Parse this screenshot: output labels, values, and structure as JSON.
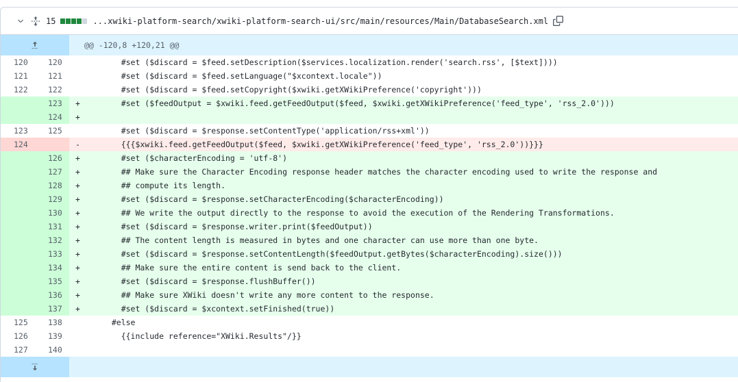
{
  "file": {
    "changes_count": "15",
    "diffstat": [
      "add",
      "add",
      "add",
      "add",
      "neutral"
    ],
    "path": "...xwiki-platform-search/xwiki-platform-search-ui/src/main/resources/Main/DatabaseSearch.xml"
  },
  "hunk_header": "@@ -120,8 +120,21 @@",
  "lines": [
    {
      "type": "ctx",
      "old": "120",
      "new": "120",
      "mark": "",
      "code": "    #set ($discard = $feed.setDescription($services.localization.render('search.rss', [$text])))"
    },
    {
      "type": "ctx",
      "old": "121",
      "new": "121",
      "mark": "",
      "code": "    #set ($discard = $feed.setLanguage(\"$xcontext.locale\"))"
    },
    {
      "type": "ctx",
      "old": "122",
      "new": "122",
      "mark": "",
      "code": "    #set ($discard = $feed.setCopyright($xwiki.getXWikiPreference('copyright')))"
    },
    {
      "type": "add",
      "old": "",
      "new": "123",
      "mark": "+",
      "code": "    #set ($feedOutput = $xwiki.feed.getFeedOutput($feed, $xwiki.getXWikiPreference('feed_type', 'rss_2.0')))"
    },
    {
      "type": "add",
      "old": "",
      "new": "124",
      "mark": "+",
      "code": ""
    },
    {
      "type": "ctx",
      "old": "123",
      "new": "125",
      "mark": "",
      "code": "    #set ($discard = $response.setContentType('application/rss+xml'))"
    },
    {
      "type": "del",
      "old": "124",
      "new": "",
      "mark": "-",
      "code": "    {{{$xwiki.feed.getFeedOutput($feed, $xwiki.getXWikiPreference('feed_type', 'rss_2.0'))}}}"
    },
    {
      "type": "add",
      "old": "",
      "new": "126",
      "mark": "+",
      "code": "    #set ($characterEncoding = 'utf-8')"
    },
    {
      "type": "add",
      "old": "",
      "new": "127",
      "mark": "+",
      "code": "    ## Make sure the Character Encoding response header matches the character encoding used to write the response and"
    },
    {
      "type": "add",
      "old": "",
      "new": "128",
      "mark": "+",
      "code": "    ## compute its length."
    },
    {
      "type": "add",
      "old": "",
      "new": "129",
      "mark": "+",
      "code": "    #set ($discard = $response.setCharacterEncoding($characterEncoding))"
    },
    {
      "type": "add",
      "old": "",
      "new": "130",
      "mark": "+",
      "code": "    ## We write the output directly to the response to avoid the execution of the Rendering Transformations."
    },
    {
      "type": "add",
      "old": "",
      "new": "131",
      "mark": "+",
      "code": "    #set ($discard = $response.writer.print($feedOutput))"
    },
    {
      "type": "add",
      "old": "",
      "new": "132",
      "mark": "+",
      "code": "    ## The content length is measured in bytes and one character can use more than one byte."
    },
    {
      "type": "add",
      "old": "",
      "new": "133",
      "mark": "+",
      "code": "    #set ($discard = $response.setContentLength($feedOutput.getBytes($characterEncoding).size()))"
    },
    {
      "type": "add",
      "old": "",
      "new": "134",
      "mark": "+",
      "code": "    ## Make sure the entire content is send back to the client."
    },
    {
      "type": "add",
      "old": "",
      "new": "135",
      "mark": "+",
      "code": "    #set ($discard = $response.flushBuffer())"
    },
    {
      "type": "add",
      "old": "",
      "new": "136",
      "mark": "+",
      "code": "    ## Make sure XWiki doesn't write any more content to the response."
    },
    {
      "type": "add",
      "old": "",
      "new": "137",
      "mark": "+",
      "code": "    #set ($discard = $xcontext.setFinished(true))"
    },
    {
      "type": "ctx",
      "old": "125",
      "new": "138",
      "mark": "",
      "code": "  #else"
    },
    {
      "type": "ctx",
      "old": "126",
      "new": "139",
      "mark": "",
      "code": "    {{include reference=\"XWiki.Results\"/}}"
    },
    {
      "type": "ctx",
      "old": "127",
      "new": "140",
      "mark": "",
      "code": ""
    }
  ],
  "colors": {
    "add_bg": "#e6ffec",
    "add_num_bg": "#ccffd8",
    "del_bg": "#ffebe9",
    "del_num_bg": "#ffd7d5",
    "hunk_bg": "#ddf4ff",
    "expander_bg": "#b6e3ff",
    "diffstat_add": "#1f883d"
  },
  "icons": {
    "collapse": "chevron-down-icon",
    "expand_all": "unfold-icon",
    "copy": "copy-icon",
    "expand_up": "fold-up-icon",
    "expand_down": "fold-down-icon"
  }
}
